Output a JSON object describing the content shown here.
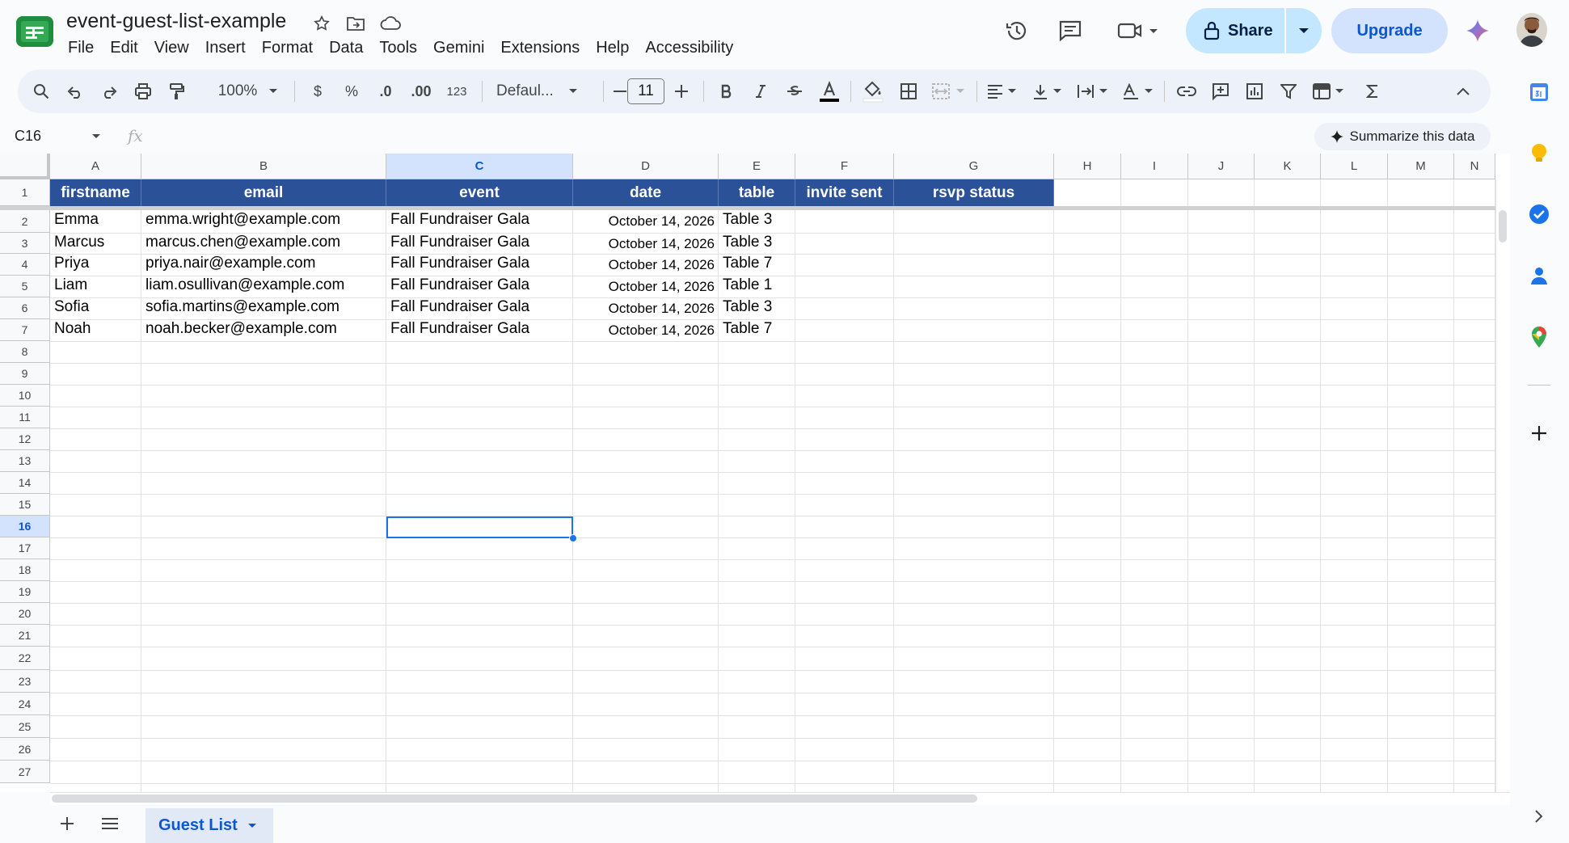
{
  "doc": {
    "title": "event-guest-list-example"
  },
  "menu": [
    "File",
    "Edit",
    "View",
    "Insert",
    "Format",
    "Data",
    "Tools",
    "Gemini",
    "Extensions",
    "Help",
    "Accessibility"
  ],
  "header_actions": {
    "share_label": "Share",
    "upgrade_label": "Upgrade"
  },
  "toolbar": {
    "zoom": "100%",
    "currency": "$",
    "percent": "%",
    "decimal_decrease": ".0",
    "decimal_increase": ".00",
    "format_number": "123",
    "font": "Defaul...",
    "font_size": "11"
  },
  "formula_bar": {
    "name_box": "C16",
    "fx": "fx",
    "summarize_label": "Summarize this data"
  },
  "columns": [
    "A",
    "B",
    "C",
    "D",
    "E",
    "F",
    "G",
    "H",
    "I",
    "J",
    "K",
    "L",
    "M",
    "N"
  ],
  "selected_column": "C",
  "rows": [
    "1",
    "2",
    "3",
    "4",
    "5",
    "6",
    "7",
    "8",
    "9",
    "10",
    "11",
    "12",
    "13",
    "14",
    "15",
    "16",
    "17",
    "18",
    "19",
    "20",
    "21",
    "22",
    "23",
    "24",
    "25",
    "26",
    "27"
  ],
  "selected_row": "16",
  "sheet": {
    "headers": [
      "firstname",
      "email",
      "event",
      "date",
      "table",
      "invite sent",
      "rsvp status"
    ],
    "data": [
      [
        "Emma",
        "emma.wright@example.com",
        "Fall Fundraiser Gala",
        "October 14, 2026",
        "Table 3"
      ],
      [
        "Marcus",
        "marcus.chen@example.com",
        "Fall Fundraiser Gala",
        "October 14, 2026",
        "Table 3"
      ],
      [
        "Priya",
        "priya.nair@example.com",
        "Fall Fundraiser Gala",
        "October 14, 2026",
        "Table 7"
      ],
      [
        "Liam",
        "liam.osullivan@example.com",
        "Fall Fundraiser Gala",
        "October 14, 2026",
        "Table 1"
      ],
      [
        "Sofia",
        "sofia.martins@example.com",
        "Fall Fundraiser Gala",
        "October 14, 2026",
        "Table 3"
      ],
      [
        "Noah",
        "noah.becker@example.com",
        "Fall Fundraiser Gala",
        "October 14, 2026",
        "Table 7"
      ]
    ]
  },
  "tabs": [
    {
      "label": "Guest List"
    }
  ],
  "colors": {
    "header_fill": "#2b5299",
    "selection": "#1a73e8",
    "share_bg": "#c2e7ff",
    "upgrade_bg": "#d3e3fd"
  }
}
